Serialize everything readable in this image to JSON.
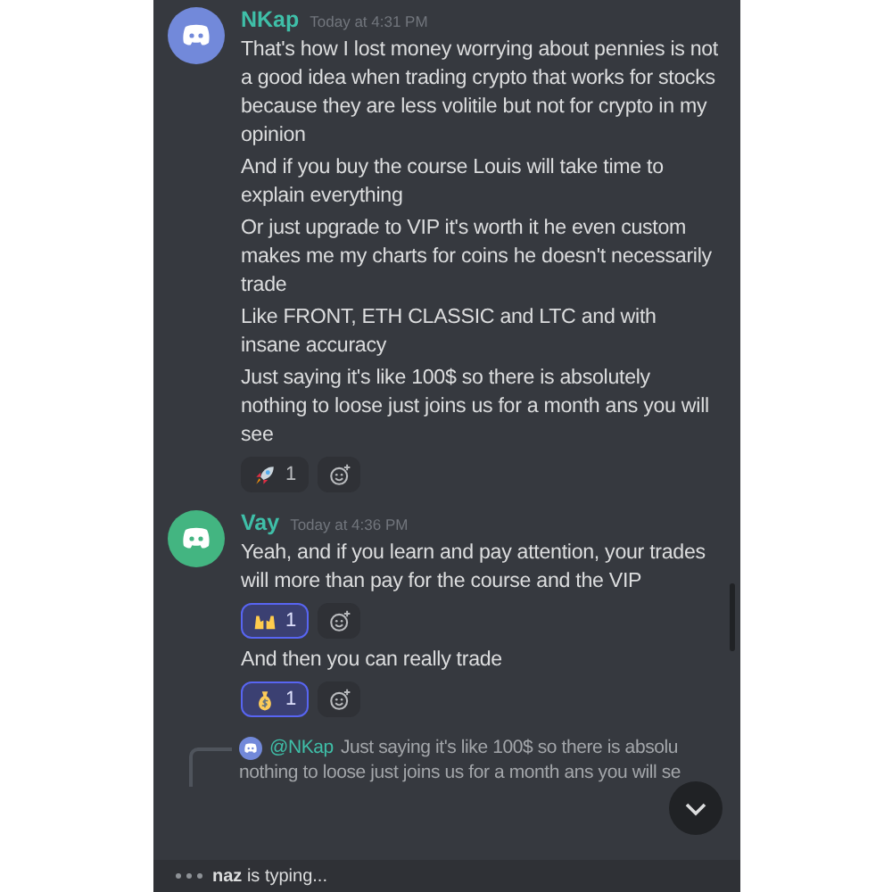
{
  "messages": [
    {
      "author": "NKap",
      "color": "#7289da",
      "timestamp": "Today at 4:31 PM",
      "items": [
        {
          "kind": "text",
          "text": "That's how I lost money worrying about pennies is not a good idea when trading crypto that works for stocks because they are less volitile but not for crypto in my opinion"
        },
        {
          "kind": "text",
          "text": "And if you buy the course Louis will take time to explain everything"
        },
        {
          "kind": "text",
          "text": "Or just upgrade to VIP it's worth it he even custom makes me my charts for coins he doesn't necessarily trade"
        },
        {
          "kind": "text",
          "text": "Like FRONT, ETH CLASSIC and LTC and with insane accuracy"
        },
        {
          "kind": "text",
          "text": "Just saying it's like 100$ so there is absolutely nothing to loose just joins us for a month ans you will see"
        },
        {
          "kind": "reactions",
          "reactions": [
            {
              "kind": "rocket",
              "count": "1",
              "selected": false
            }
          ]
        }
      ]
    },
    {
      "author": "Vay",
      "color": "#43b581",
      "timestamp": "Today at 4:36 PM",
      "items": [
        {
          "kind": "text",
          "text": "Yeah, and if you learn and pay attention, your trades will more than pay for the course and the VIP"
        },
        {
          "kind": "reactions",
          "reactions": [
            {
              "kind": "hands",
              "count": "1",
              "selected": true
            }
          ]
        },
        {
          "kind": "text",
          "text": "And then you can really trade"
        },
        {
          "kind": "reactions",
          "reactions": [
            {
              "kind": "moneybag",
              "count": "1",
              "selected": true
            }
          ]
        }
      ]
    }
  ],
  "reply": {
    "mention": "@NKap",
    "lines": [
      "Just saying it's like 100$ so there is absolu",
      "nothing to loose just joins us for a month ans you will se"
    ]
  },
  "typing": "**naz** is typing..."
}
